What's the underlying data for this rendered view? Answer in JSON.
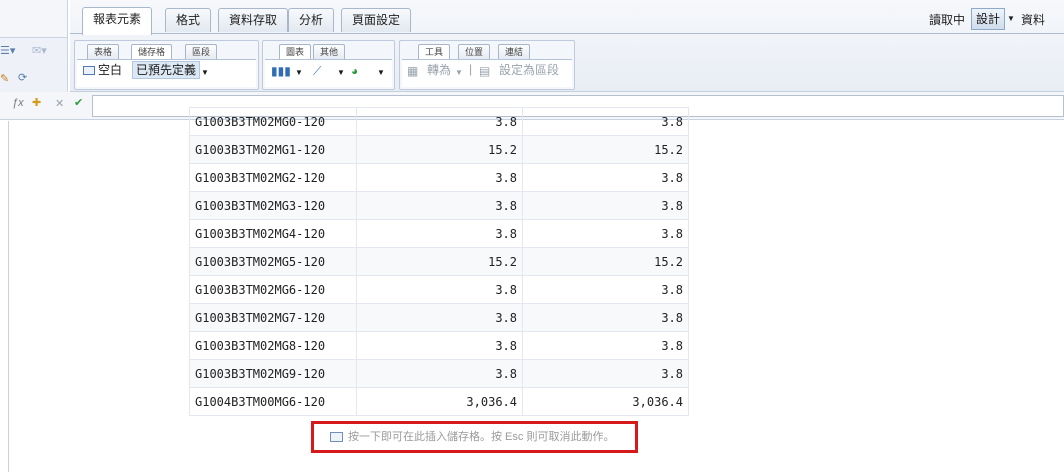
{
  "ribbon": {
    "tabs": [
      "報表元素",
      "格式",
      "資料存取",
      "分析",
      "頁面設定"
    ],
    "mode": {
      "reading": "讀取中",
      "design": "設計",
      "data": "資料"
    },
    "groups": [
      {
        "subtabs": [
          "表格",
          "儲存格",
          "區段"
        ],
        "blank_label": "空白",
        "preset_label": "已預先定義"
      },
      {
        "subtabs": [
          "圖表",
          "其他"
        ]
      },
      {
        "subtabs": [
          "工具",
          "位置",
          "連結"
        ],
        "convert_label": "轉為",
        "set_section_label": "設定為區段"
      }
    ]
  },
  "formula_bar": {
    "value": ""
  },
  "grid": {
    "rows": [
      {
        "c1": "G1003B3TM02MG0-120",
        "c2": "3.8",
        "c3": "3.8"
      },
      {
        "c1": "G1003B3TM02MG1-120",
        "c2": "15.2",
        "c3": "15.2"
      },
      {
        "c1": "G1003B3TM02MG2-120",
        "c2": "3.8",
        "c3": "3.8"
      },
      {
        "c1": "G1003B3TM02MG3-120",
        "c2": "3.8",
        "c3": "3.8"
      },
      {
        "c1": "G1003B3TM02MG4-120",
        "c2": "3.8",
        "c3": "3.8"
      },
      {
        "c1": "G1003B3TM02MG5-120",
        "c2": "15.2",
        "c3": "15.2"
      },
      {
        "c1": "G1003B3TM02MG6-120",
        "c2": "3.8",
        "c3": "3.8"
      },
      {
        "c1": "G1003B3TM02MG7-120",
        "c2": "3.8",
        "c3": "3.8"
      },
      {
        "c1": "G1003B3TM02MG8-120",
        "c2": "3.8",
        "c3": "3.8"
      },
      {
        "c1": "G1003B3TM02MG9-120",
        "c2": "3.8",
        "c3": "3.8"
      },
      {
        "c1": "G1004B3TM00MG6-120",
        "c2": "3,036.4",
        "c3": "3,036.4"
      }
    ]
  },
  "hint": {
    "text": "按一下即可在此插入儲存格。按 Esc 則可取消此動作。"
  },
  "colors": {
    "accent": "#d7191c",
    "border": "#c7d2e0"
  }
}
